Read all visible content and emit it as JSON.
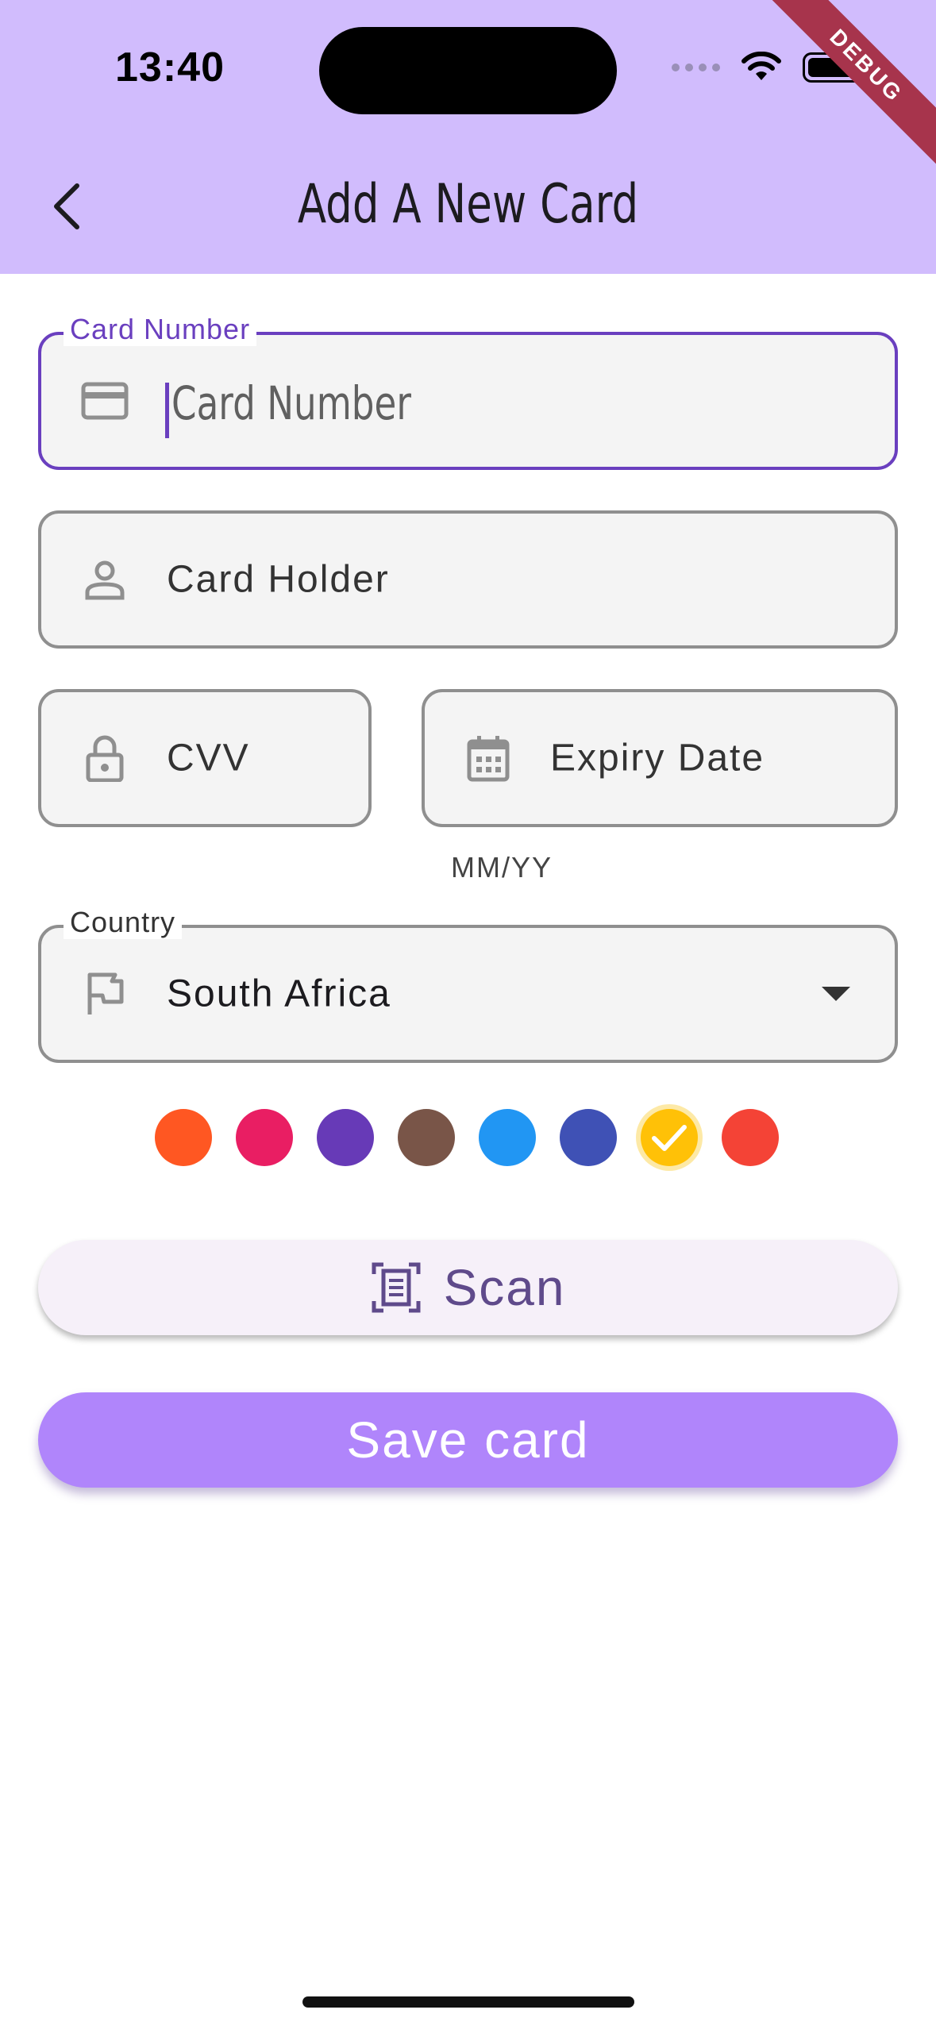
{
  "status_bar": {
    "time": "13:40",
    "debug_label": "DEBUG"
  },
  "header": {
    "title": "Add A New Card",
    "back_icon": "chevron-left-icon"
  },
  "form": {
    "card_number": {
      "label": "Card Number",
      "placeholder": "Card Number",
      "icon": "credit-card-icon"
    },
    "card_holder": {
      "placeholder": "Card Holder",
      "icon": "person-icon"
    },
    "cvv": {
      "placeholder": "CVV",
      "icon": "lock-icon"
    },
    "expiry": {
      "placeholder": "Expiry Date",
      "helper": "MM/YY",
      "icon": "calendar-icon"
    },
    "country": {
      "label": "Country",
      "value": "South Africa",
      "icon": "flag-icon"
    }
  },
  "color_options": [
    {
      "color": "#ff5722",
      "selected": false
    },
    {
      "color": "#e91e63",
      "selected": false
    },
    {
      "color": "#673ab7",
      "selected": false
    },
    {
      "color": "#795548",
      "selected": false
    },
    {
      "color": "#2196f3",
      "selected": false
    },
    {
      "color": "#3f51b5",
      "selected": false
    },
    {
      "color": "#ffc107",
      "selected": true
    },
    {
      "color": "#f44336",
      "selected": false
    }
  ],
  "buttons": {
    "scan": "Scan",
    "save": "Save card"
  },
  "theme": {
    "appbar": "#d1bcfd",
    "accent": "#6a3fbf",
    "save_button": "#b085fb"
  }
}
